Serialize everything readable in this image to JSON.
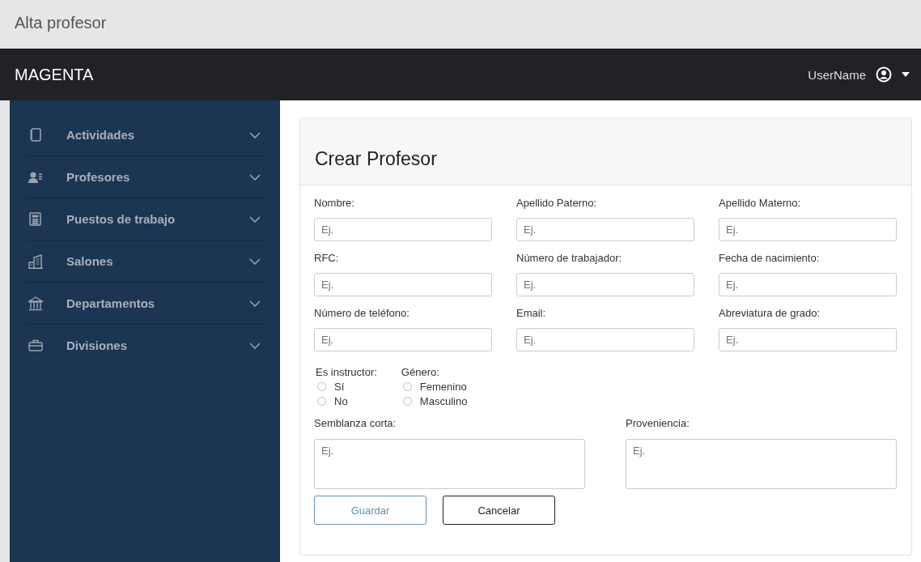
{
  "window": {
    "title": "Alta profesor"
  },
  "header": {
    "brand": "MAGENTA",
    "user": "UserName"
  },
  "sidebar": {
    "items": [
      {
        "label": "Actividades",
        "expanded": false
      },
      {
        "label": "Profesores",
        "expanded": false
      },
      {
        "label": "Puestos de trabajo",
        "expanded": false
      },
      {
        "label": "Salones",
        "expanded": false
      },
      {
        "label": "Departamentos",
        "expanded": false
      },
      {
        "label": "Divisiones",
        "expanded": false
      }
    ]
  },
  "form": {
    "title": "Crear Profesor",
    "fields": [
      {
        "label": "Nombre:",
        "placeholder": "Ej."
      },
      {
        "label": "Apellido Paterno:",
        "placeholder": "Ej."
      },
      {
        "label": "Apellido Materno:",
        "placeholder": "Ej."
      },
      {
        "label": "RFC:",
        "placeholder": "Ej."
      },
      {
        "label": "Número de trabajador:",
        "placeholder": "Ej."
      },
      {
        "label": "Fecha de nacimiento:",
        "placeholder": "Ej."
      },
      {
        "label": "Número de teléfono:",
        "placeholder": "Ej."
      },
      {
        "label": "Email:",
        "placeholder": "Ej."
      },
      {
        "label": "Abreviatura de grado:",
        "placeholder": "Ej."
      }
    ],
    "radio_groups": [
      {
        "label": "Es instructor:",
        "options": [
          {
            "label": "Sí",
            "selected": false
          },
          {
            "label": "No",
            "selected": false
          }
        ]
      },
      {
        "label": "Género:",
        "options": [
          {
            "label": "Femenino",
            "selected": false
          },
          {
            "label": "Masculino",
            "selected": false
          }
        ]
      }
    ],
    "textareas": [
      {
        "label": "Semblanza corta:",
        "placeholder": "Ej."
      },
      {
        "label": "Proveniencia:",
        "placeholder": "Ej."
      }
    ],
    "buttons": [
      {
        "label": "Guardar",
        "kind": "primary"
      },
      {
        "label": "Cancelar",
        "kind": "secondary"
      }
    ]
  }
}
